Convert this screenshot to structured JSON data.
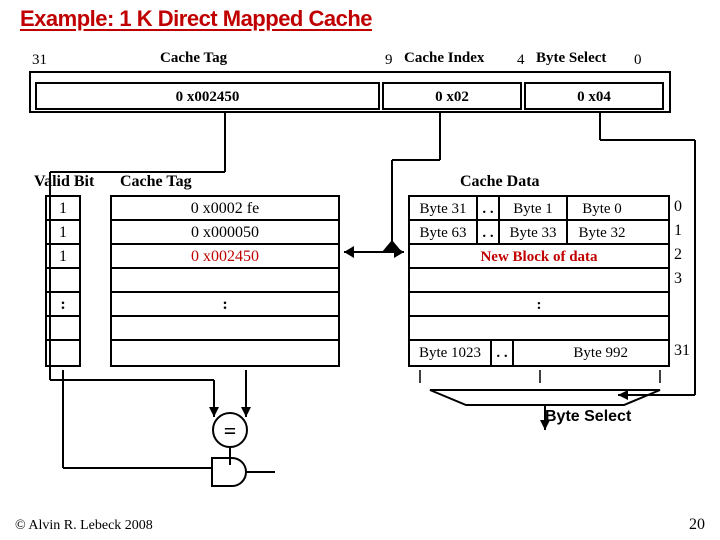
{
  "title": "Example: 1 K Direct Mapped Cache",
  "address": {
    "bit31": "31",
    "tag_label": "Cache Tag",
    "bit9": "9",
    "index_label": "Cache Index",
    "bit4": "4",
    "byte_label": "Byte Select",
    "bit0": "0",
    "tag_value": "0 x002450",
    "index_value": "0 x02",
    "byte_value": "0 x04"
  },
  "headers": {
    "valid": "Valid Bit",
    "tag": "Cache Tag",
    "data": "Cache Data"
  },
  "valid_bits": [
    "1",
    "1",
    "1"
  ],
  "tags": [
    "0 x0002 fe",
    "0 x000050",
    "0 x002450"
  ],
  "data_rows": [
    {
      "left": "Byte 31",
      "mid1": "Byte 1",
      "mid2": "Byte 0",
      "idx": "0"
    },
    {
      "left": "Byte 63",
      "mid1": "Byte 33",
      "mid2": "Byte 32",
      "idx": "1"
    }
  ],
  "new_block_label": "New Block of data",
  "idx2": "2",
  "idx3": "3",
  "last_row": {
    "left": "Byte 1023",
    "right": "Byte 992",
    "idx": "31"
  },
  "compare": "=",
  "byte_select_label": "Byte Select",
  "footer": {
    "left": "© Alvin R. Lebeck 2008",
    "right": "20"
  },
  "ellipsis": ":",
  "hdots": ". ."
}
